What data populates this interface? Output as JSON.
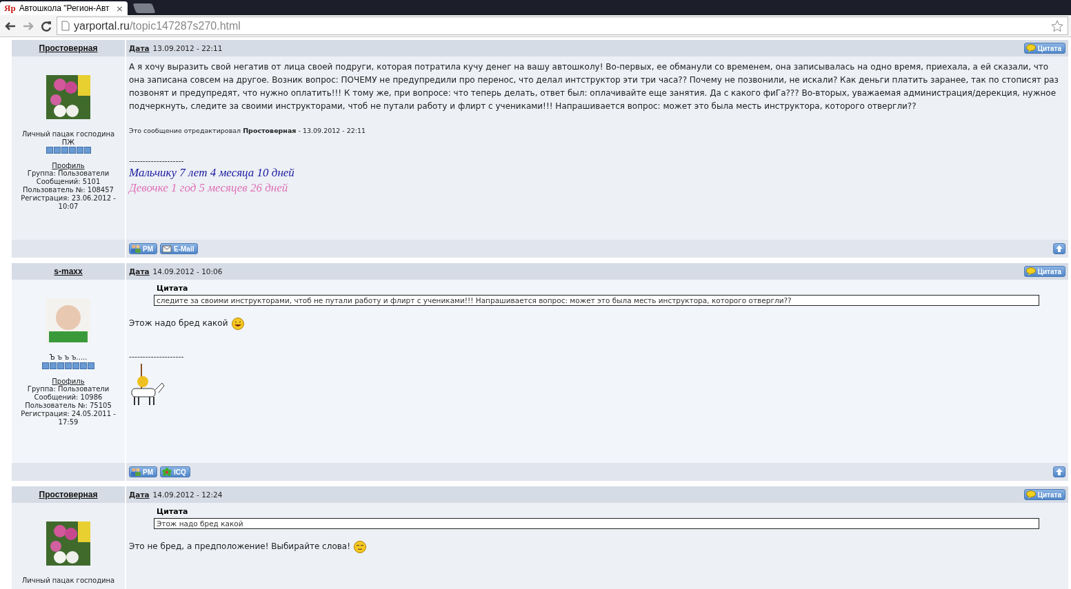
{
  "browser": {
    "favicon_text": "Яр",
    "tab_title": "Автошкола \"Регион-Авт",
    "tab_close": "×",
    "url_host": "yarportal.ru",
    "url_path": "/topic147287s270.html"
  },
  "posts": [
    {
      "author": "Простоверная",
      "date_label": "Дата",
      "date": "13.09.2012 - 22:11",
      "quote_button": "Цитата",
      "avatar": {
        "kind": "tulips"
      },
      "rank": "Личный пацак господина ПЖ",
      "stars": 6,
      "profile_link": "Профиль",
      "details": [
        "Группа: Пользователи",
        "Сообщений: 5101",
        "Пользователь №: 108457",
        "Регистрация: 23.06.2012 - 10:07"
      ],
      "message": "А я хочу выразить свой негатив от лица своей подруги, которая потратила кучу денег на вашу автошколу! Во-первых, ее обманули со временем, она записывалась на одно время, приехала, а ей сказали, что она записана совсем на другое. Возник вопрос: ПОЧЕМУ не предупредили про перенос, что делал интструктор эти три часа?? Почему не позвонили, не искали? Как деньги платить заранее, так по стописят раз позвонят и предупредят, что нужно оплатить!!! К тому же, при вопросе: что теперь делать, ответ был: оплачивайте еще занятия. Да с какого фиГа??? Во-вторых, уважаемая администрация/дерекция, нужное подчеркнуть, следите за своими инструкторами, чтоб не путали работу и флирт с учениками!!! Напрашивается вопрос: может это была месть инструктора, которого отвергли??",
      "edit_note": "Это сообщение отредактировал **Простоверная** - 13.09.2012 - 22:11",
      "separator": "--------------------",
      "signature": [
        {
          "text": "Мальчику 7 лет  4 месяца  10 дней",
          "color": "#1a1aa0"
        },
        {
          "text": "Девочке 1 год  5 месяцев  26 дней",
          "color": "#e070b8"
        }
      ],
      "buttons": [
        {
          "label": "PM",
          "kind": "pm"
        },
        {
          "label": "E-Mail",
          "kind": "email"
        }
      ]
    },
    {
      "author": "s-maxx",
      "date_label": "Дата",
      "date": "14.09.2012 - 10:06",
      "quote_button": "Цитата",
      "avatar": {
        "kind": "cartoon"
      },
      "rank": "Ъ ъ ъ ъ.....",
      "stars": 7,
      "profile_link": "Профиль",
      "details": [
        "Группа: Пользователи",
        "Сообщений: 10986",
        "Пользователь №: 75105",
        "Регистрация: 24.05.2011 - 17:59"
      ],
      "quote": {
        "title": "Цитата",
        "text": "следите за своими инструкторами, чтоб не путали работу и флирт с учениками!!! Напрашивается вопрос: может это была месть инструктора, которого отвергли??"
      },
      "message": "Этож надо бред какой",
      "smiley": {
        "kind": "laugh"
      },
      "separator": "--------------------",
      "signature_picture": {
        "kind": "rider"
      },
      "buttons": [
        {
          "label": "PM",
          "kind": "pm"
        },
        {
          "label": "ICQ",
          "kind": "icq"
        }
      ]
    },
    {
      "author": "Простоверная",
      "date_label": "Дата",
      "date": "14.09.2012 - 12:24",
      "quote_button": "Цитата",
      "avatar": {
        "kind": "tulips"
      },
      "rank": "Личный пацак господина",
      "quote": {
        "title": "Цитата",
        "text": "Этож надо бред какой"
      },
      "message": "Это не бред, а предположение! Выбирайте слова!",
      "smiley": {
        "kind": "sly"
      }
    }
  ]
}
